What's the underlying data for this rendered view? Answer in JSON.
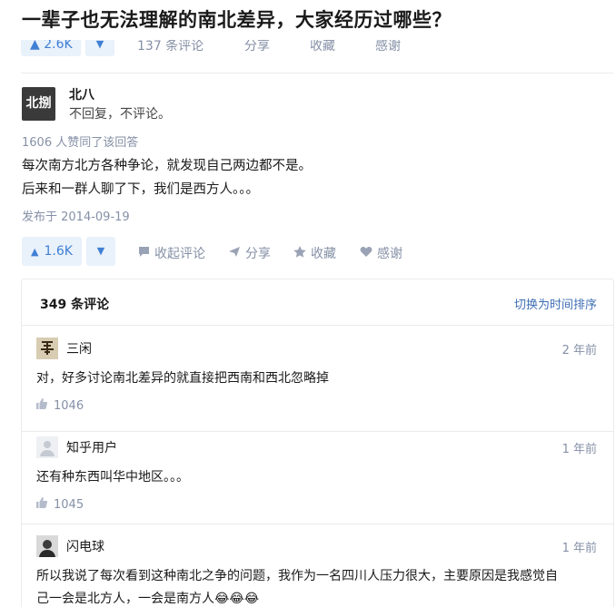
{
  "title": "一辈子也无法理解的南北差异，大家经历过哪些？",
  "previous_actions": {
    "upvote": "▲ 2.6K",
    "downvote": "▼",
    "comments": "137 条评论",
    "share": "分享",
    "collect": "收藏",
    "thanks": "感谢"
  },
  "answer": {
    "author": {
      "avatar_text": "北捌",
      "name": "北八",
      "bio": "不回复，不评论。"
    },
    "vote_summary": "1606 人赞同了该回答",
    "lines": [
      "每次南方北方各种争论，就发现自己两边都不是。",
      "后来和一群人聊了下，我们是西方人。。。"
    ],
    "publish_date": "发布于 2014-09-19",
    "actions": {
      "upvote_icon": "▲",
      "upvote_count": "1.6K",
      "downvote_icon": "▼",
      "collapse_comments": "收起评论",
      "share": "分享",
      "collect": "收藏",
      "thanks": "感谢"
    }
  },
  "icons": {
    "comment": "comment-bubble-icon",
    "share": "paper-plane-icon",
    "collect": "star-icon",
    "thanks": "heart-icon",
    "like": "thumb-up-icon"
  },
  "comments": {
    "count_label": "349 条评论",
    "sort_toggle": "切换为时间排序",
    "items": [
      {
        "name": "三闲",
        "time": "2 年前",
        "text_lines": [
          "对，好多讨论南北差异的就直接把西南和西北忽略掉"
        ],
        "likes": "1046"
      },
      {
        "name": "知乎用户",
        "time": "1 年前",
        "text_lines": [
          "还有种东西叫华中地区。。。"
        ],
        "likes": "1045"
      },
      {
        "name": "闪电球",
        "time": "1 年前",
        "text_lines": [
          "所以我说了每次看到这种南北之争的问题，我作为一名四川人压力很大，主要原因是我感觉自",
          "己一会是北方人，一会是南方人😂😂😂"
        ]
      }
    ]
  },
  "colors": {
    "accent": "#3f7fd4",
    "vote_bg": "#e9f1fb",
    "muted": "#8590a6",
    "link": "#3f6fb5"
  }
}
